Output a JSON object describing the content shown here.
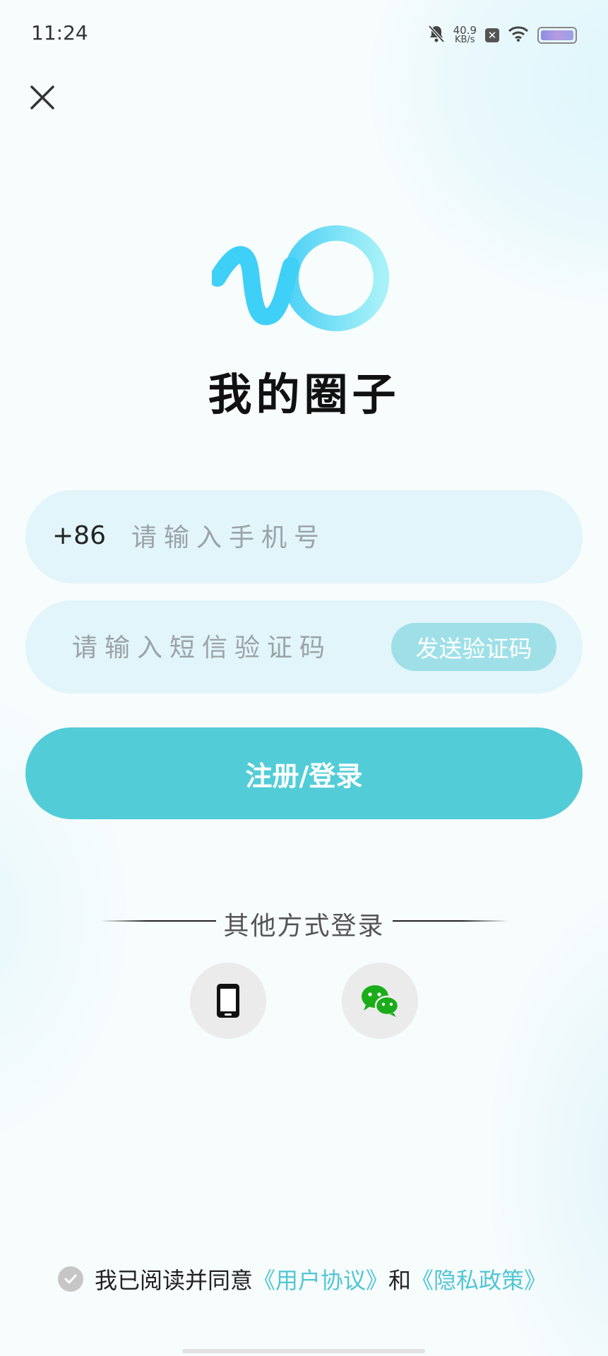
{
  "status_bar": {
    "time": "11:24",
    "net_speed_value": "40.9",
    "net_speed_unit": "KB/s",
    "icons": [
      "bell-muted-icon",
      "x-badge-icon",
      "wifi-icon",
      "battery-icon"
    ]
  },
  "header": {
    "close_icon": "close-icon"
  },
  "brand": {
    "app_name": "我的圈子",
    "logo": "app-logo-icon",
    "logo_colors": [
      "#3ecdf5",
      "#9ef0f7"
    ]
  },
  "form": {
    "country_code": "+86",
    "phone_placeholder": "请输入手机号",
    "code_placeholder": "请输入短信验证码",
    "send_code_label": "发送验证码",
    "login_label": "注册/登录"
  },
  "other_login": {
    "label": "其他方式登录",
    "methods": [
      {
        "icon": "mobile-phone-icon"
      },
      {
        "icon": "wechat-icon"
      }
    ]
  },
  "agreement": {
    "prefix": "我已阅读并同意",
    "user_agreement": "《用户协议》",
    "and": "和",
    "privacy_policy": "《隐私政策》"
  },
  "colors": {
    "accent": "#52cdd8",
    "send_code_bg": "#9fe0e8",
    "input_bg": "#e1f5fb",
    "link": "#52c6d3",
    "wechat_green": "#1aad19"
  }
}
